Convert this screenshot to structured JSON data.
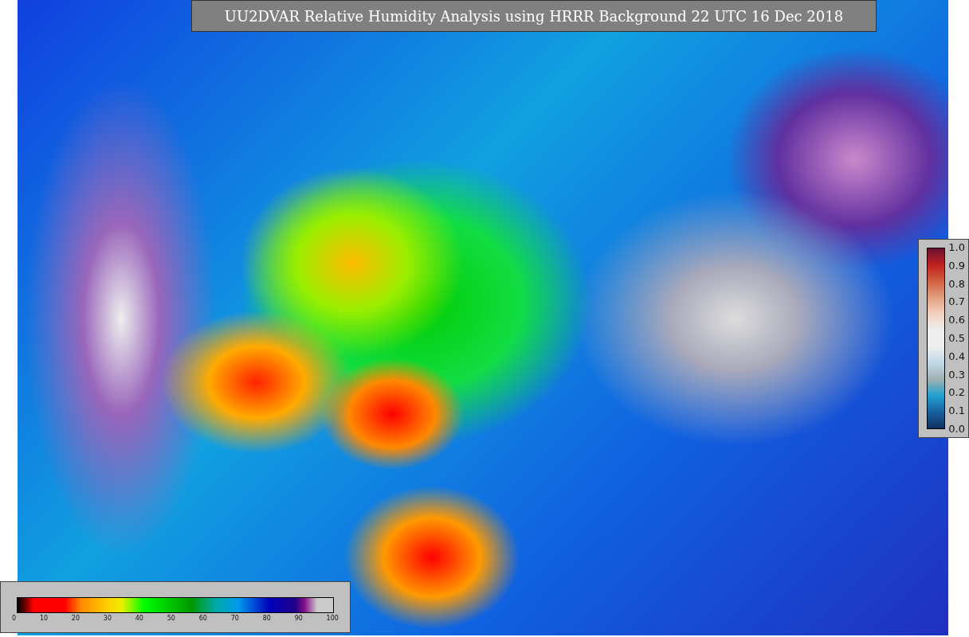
{
  "title": "UU2DVAR Relative Humidity Analysis using HRRR Background 22 UTC 16 Dec 2018",
  "ratio_colorbar": {
    "ticks": [
      "1.0",
      "0.9",
      "0.8",
      "0.7",
      "0.6",
      "0.5",
      "0.4",
      "0.3",
      "0.2",
      "0.1",
      "0.0"
    ]
  },
  "percent_colorbar": {
    "ticks": [
      "0",
      "10",
      "20",
      "30",
      "40",
      "50",
      "60",
      "70",
      "80",
      "90",
      "100"
    ]
  }
}
